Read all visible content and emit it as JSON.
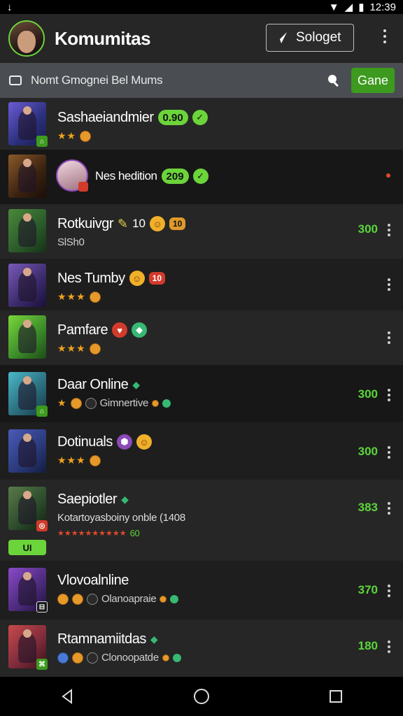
{
  "status": {
    "time": "12:39"
  },
  "header": {
    "title": "Komumitas",
    "suggest_label": "Sologet"
  },
  "search": {
    "placeholder": "Nomt Gmognei Bel Mums",
    "go_label": "Gane"
  },
  "colors": {
    "accent": "#6bd43a",
    "button": "#3d9a1e",
    "score": "#5bd63a"
  },
  "rows": [
    {
      "name": "Sashaeiandmier",
      "pill": "0.90",
      "sub": "",
      "score": "",
      "stars": "★★"
    },
    {
      "name": "Nes hedition",
      "pill": "209",
      "sub": "",
      "score": "",
      "stars": ""
    },
    {
      "name": "Rotkuivgr",
      "badge": "10",
      "sub": "SlSh0",
      "score": "300",
      "stars": ""
    },
    {
      "name": "Nes Tumby",
      "badge": "10",
      "sub": "",
      "score": "",
      "stars": "★★★"
    },
    {
      "name": "Pamfare",
      "sub": "",
      "score": "",
      "stars": "★★★"
    },
    {
      "name": "Daar Online",
      "sub": "Gimnertive",
      "score": "300",
      "stars": "★"
    },
    {
      "name": "Dotinuals",
      "sub": "",
      "score": "300",
      "stars": "★★★"
    },
    {
      "name": "Saepiotler",
      "sub": "Kotartoyasboiny onble (1408",
      "score": "383",
      "stars": "★★★★★★★★★★",
      "tag": "60",
      "label": "UI"
    },
    {
      "name": "Vlovoalnline",
      "sub": "Olanoapraie",
      "score": "370",
      "stars": ""
    },
    {
      "name": "Rtamnamiitdas",
      "sub": "Clonoopatde",
      "score": "180",
      "stars": ""
    }
  ]
}
